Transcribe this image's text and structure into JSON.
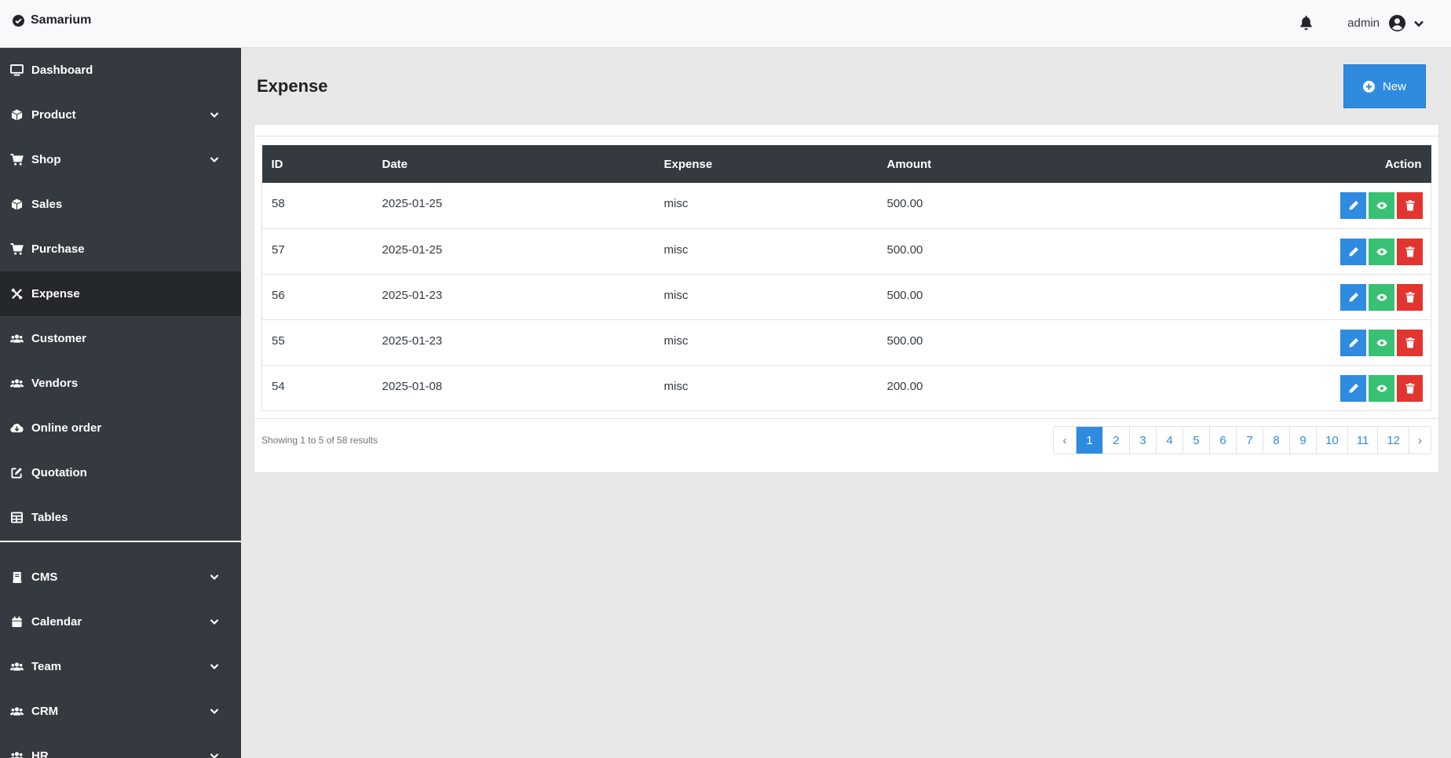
{
  "brand": {
    "name": "Samarium",
    "icon": "check-circle-icon"
  },
  "header": {
    "username": "admin"
  },
  "sidebar": {
    "items": [
      {
        "label": "Dashboard",
        "icon": "monitor-icon",
        "has_chevron": false
      },
      {
        "label": "Product",
        "icon": "box-icon",
        "has_chevron": true
      },
      {
        "label": "Shop",
        "icon": "cart-icon",
        "has_chevron": true
      },
      {
        "label": "Sales",
        "icon": "box-icon",
        "has_chevron": false
      },
      {
        "label": "Purchase",
        "icon": "cart-icon",
        "has_chevron": false
      },
      {
        "label": "Expense",
        "icon": "tools-icon",
        "has_chevron": false,
        "active": true
      },
      {
        "label": "Customer",
        "icon": "users-icon",
        "has_chevron": false
      },
      {
        "label": "Vendors",
        "icon": "users-icon",
        "has_chevron": false
      },
      {
        "label": "Online order",
        "icon": "cloud-download-icon",
        "has_chevron": false
      },
      {
        "label": "Quotation",
        "icon": "edit-icon",
        "has_chevron": false
      },
      {
        "label": "Tables",
        "icon": "table-icon",
        "has_chevron": false
      }
    ],
    "items2": [
      {
        "label": "CMS",
        "icon": "book-icon",
        "has_chevron": true
      },
      {
        "label": "Calendar",
        "icon": "calendar-icon",
        "has_chevron": true
      },
      {
        "label": "Team",
        "icon": "users-icon",
        "has_chevron": true
      },
      {
        "label": "CRM",
        "icon": "users-icon",
        "has_chevron": true
      },
      {
        "label": "HR",
        "icon": "users-icon",
        "has_chevron": true
      }
    ]
  },
  "main": {
    "title": "Expense",
    "new_label": "New",
    "columns": {
      "id": "ID",
      "date": "Date",
      "expense": "Expense",
      "amount": "Amount",
      "action": "Action"
    },
    "rows": [
      {
        "id": "58",
        "date": "2025-01-25",
        "expense": "misc",
        "amount": "500.00"
      },
      {
        "id": "57",
        "date": "2025-01-25",
        "expense": "misc",
        "amount": "500.00"
      },
      {
        "id": "56",
        "date": "2025-01-23",
        "expense": "misc",
        "amount": "500.00"
      },
      {
        "id": "55",
        "date": "2025-01-23",
        "expense": "misc",
        "amount": "500.00"
      },
      {
        "id": "54",
        "date": "2025-01-08",
        "expense": "misc",
        "amount": "200.00"
      }
    ],
    "showing": "Showing 1 to 5 of 58 results",
    "pagination": {
      "prev": "‹",
      "next": "›",
      "pages": [
        "1",
        "2",
        "3",
        "4",
        "5",
        "6",
        "7",
        "8",
        "9",
        "10",
        "11",
        "12"
      ],
      "current": "1"
    }
  },
  "colors": {
    "sidebar": "#343a40",
    "primary": "#2f8be0",
    "success": "#38c172",
    "danger": "#e3342f"
  }
}
